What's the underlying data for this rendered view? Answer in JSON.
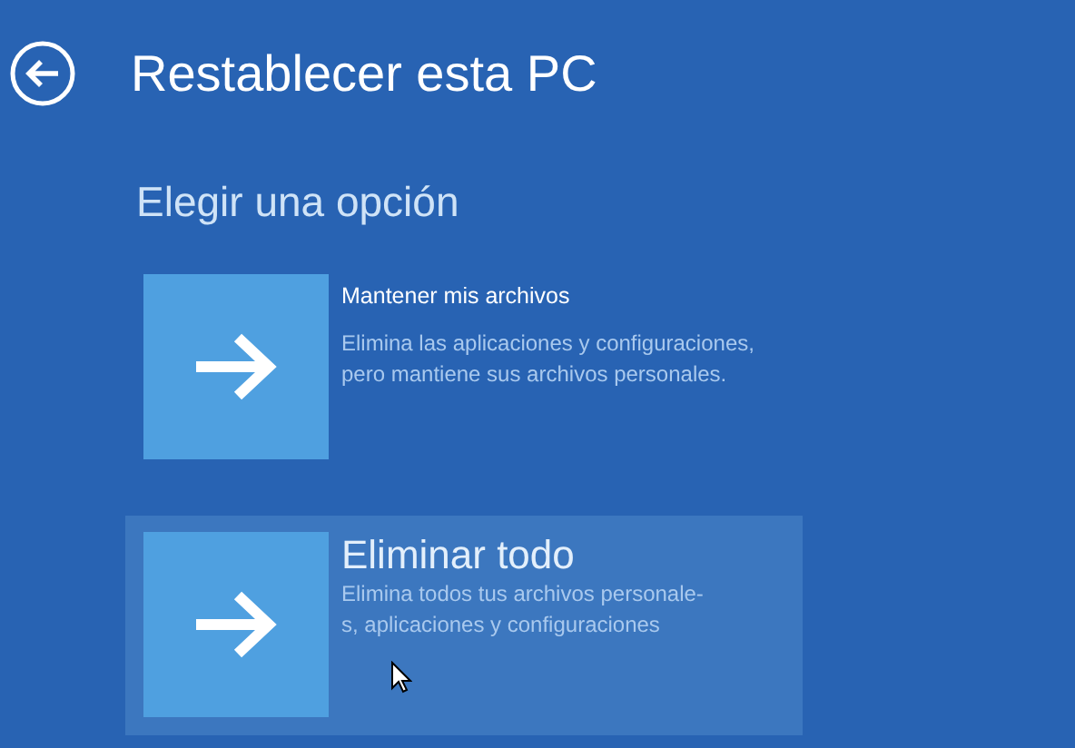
{
  "window": {
    "title": "Restablecer esta PC"
  },
  "heading": "Elegir una opción",
  "options": [
    {
      "title": "Mantener mis archivos",
      "description_lines": [
        "Elimina las aplicaciones y configuraciones,",
        "pero mantiene sus archivos personales."
      ],
      "selected": false
    },
    {
      "title": "Eliminar todo",
      "description_lines": [
        "Elimina todos tus archivos personale-",
        "s, aplicaciones y configuraciones"
      ],
      "selected": true
    }
  ]
}
